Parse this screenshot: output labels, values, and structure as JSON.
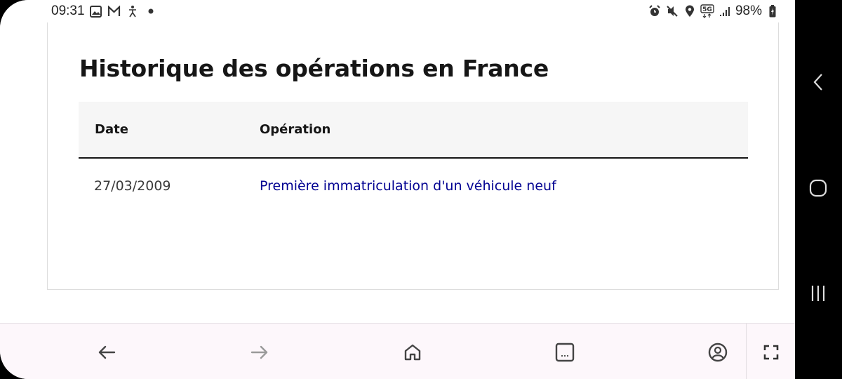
{
  "status_bar": {
    "time": "09:31",
    "left_icons": [
      "gallery-icon",
      "gmail-icon",
      "accessibility-icon",
      "dot-icon"
    ],
    "right_icons": [
      "alarm-icon",
      "mute-icon",
      "location-icon",
      "5g-icon",
      "signal-icon"
    ],
    "battery": "98%"
  },
  "page": {
    "title": "Historique des opérations en France",
    "table": {
      "headers": [
        "Date",
        "Opération"
      ],
      "rows": [
        {
          "date": "27/03/2009",
          "operation": "Première immatriculation d'un véhicule neuf"
        }
      ]
    },
    "colors": {
      "link": "#000091",
      "header_bg": "#f6f6f6",
      "text": "#161616"
    }
  },
  "toolbar": {
    "buttons": [
      "back-icon",
      "forward-icon",
      "home-icon",
      "tabs-icon",
      "account-icon",
      "fullscreen-icon"
    ],
    "tabs_label": "..."
  },
  "navbar": {
    "buttons": [
      "back",
      "home",
      "recents"
    ]
  }
}
